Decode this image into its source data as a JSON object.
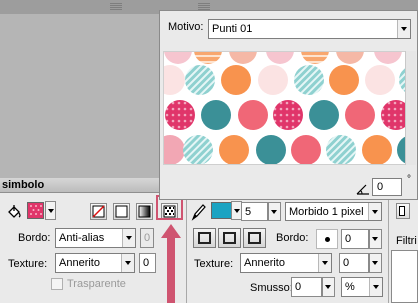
{
  "pattern_popup": {
    "motivo_label": "Motivo:",
    "motivo_value": "Punti 01",
    "angle_value": "0",
    "degree_symbol": "°"
  },
  "panel": {
    "tab_label": "simbolo",
    "colors": {
      "fill_swatch": "#e0356a",
      "stroke_swatch": "#1ba3c2",
      "highlight": "#cf5470"
    },
    "left": {
      "bordo_label": "Bordo:",
      "bordo_value": "Anti-alias",
      "disabled_value": "0",
      "texture_label": "Texture:",
      "texture_value": "Annerito",
      "texture_num": "0",
      "trasparente_label": "Trasparente"
    },
    "right": {
      "stroke_size": "5",
      "stroke_type": "Morbido 1 pixel",
      "bordo_label": "Bordo:",
      "bordo_value": "0",
      "texture_label": "Texture:",
      "texture_value": "Annerito",
      "texture_num": "0",
      "smusso_label": "Smusso:",
      "smusso_value": "0",
      "smusso_unit": "%"
    },
    "filtri_label": "Filtri"
  }
}
